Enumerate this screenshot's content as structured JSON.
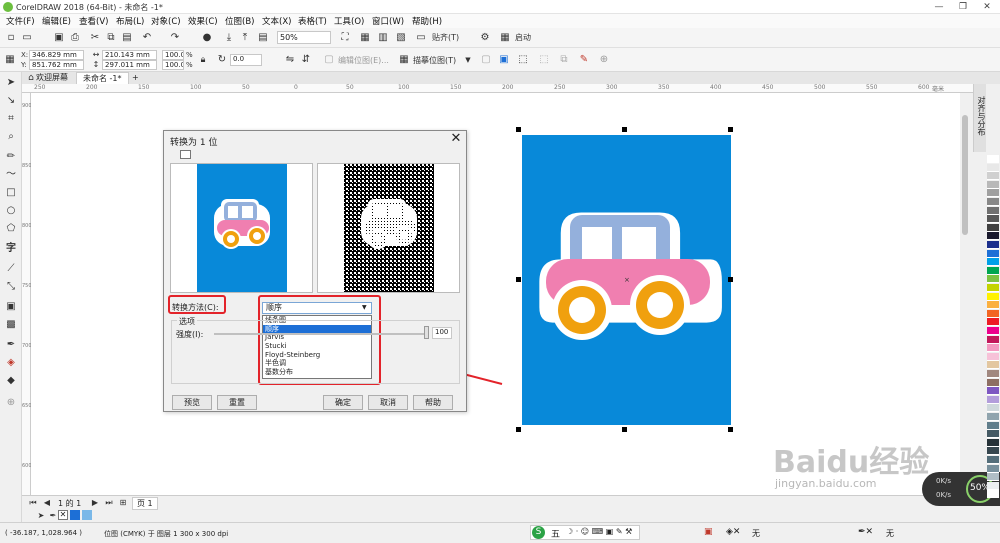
{
  "window": {
    "title": "CorelDRAW 2018 (64-Bit) - 未命名 -1*",
    "minimize": "—",
    "restore": "❐",
    "close": "✕"
  },
  "menu": [
    "文件(F)",
    "编辑(E)",
    "查看(V)",
    "布局(L)",
    "对象(C)",
    "效果(C)",
    "位图(B)",
    "文本(X)",
    "表格(T)",
    "工具(O)",
    "窗口(W)",
    "帮助(H)"
  ],
  "toolbar": {
    "zoom_value": "50%",
    "snap_label": "贴齐(T)",
    "launch_label": "启动"
  },
  "propbar": {
    "x_label": "X:",
    "x_value": "346.829 mm",
    "y_label": "Y:",
    "y_value": "851.762 mm",
    "w_value": "210.143 mm",
    "h_value": "297.011 mm",
    "scale_w": "100.0",
    "scale_h": "100.0",
    "percent": "%",
    "rotate_value": "0.0",
    "edit_bitmap": "编辑位图(E)...",
    "trace_bitmap": "描摹位图(T)"
  },
  "doctabs": {
    "welcome": "欢迎屏幕",
    "doc": "未命名 -1*",
    "add": "+"
  },
  "ruler": {
    "ticks_h": [
      "250",
      "200",
      "150",
      "100",
      "50",
      "0",
      "50",
      "100",
      "150",
      "200",
      "250",
      "300",
      "350",
      "400",
      "450",
      "500",
      "550",
      "600"
    ],
    "ticks_v": [
      "900",
      "850",
      "800",
      "750",
      "700",
      "650",
      "600"
    ],
    "unit": "毫米"
  },
  "docker": {
    "label": "对齐与分布"
  },
  "dialog": {
    "title": "转换为 1 位",
    "close": "✕",
    "method_label": "转换方法(C):",
    "method_selected": "顺序",
    "options_label": "选项",
    "strength_label": "强度(I):",
    "strength_value": "100",
    "dropdown_options": [
      "线条图",
      "顺序",
      "Jarvis",
      "Stucki",
      "Floyd-Steinberg",
      "半色调",
      "基数分布"
    ],
    "dropdown_selected_index": 1,
    "buttons": {
      "preview": "预览",
      "reset": "重置",
      "ok": "确定",
      "cancel": "取消",
      "help": "帮助"
    }
  },
  "pagebar": {
    "page_of": "1 的 1",
    "page_tab": "页 1"
  },
  "status": {
    "coords": "( -36.187, 1,028.964 )",
    "object_info": "位图 (CMYK) 于 图层 1 300 x 300 dpi",
    "ime_label": "五",
    "fill_none": "无",
    "outline_none": "无"
  },
  "watermark": {
    "brand": "Baidu经验",
    "url": "jingyan.baidu.com"
  },
  "gauge": {
    "value": "50%",
    "up": "0K/s",
    "down": "0K/s"
  },
  "colors": {
    "accent": "#1d6fd6",
    "image_blue": "#0889d9",
    "car_body": "#f07fb0",
    "car_roof": "#94b0dc",
    "wheel": "#f0a00e",
    "annotation_red": "#e3232a",
    "palette": [
      "#ffffff",
      "#e8e8e8",
      "#d0d0d0",
      "#b8b8b8",
      "#a0a0a0",
      "#888888",
      "#707070",
      "#585858",
      "#404040",
      "#1a1a2e",
      "#1c2f8c",
      "#1d6fd6",
      "#00a0e8",
      "#00a651",
      "#7dc242",
      "#c3d300",
      "#fff200",
      "#fbb040",
      "#f26522",
      "#ed1c24",
      "#ec008c",
      "#c2185b",
      "#f49ac1",
      "#f7c2d8",
      "#e3c7a0",
      "#a1887f",
      "#8d6e63",
      "#7e57c2",
      "#b39ddb",
      "#cfd8dc",
      "#90a4ae",
      "#607d8b",
      "#455a64",
      "#263238",
      "#37474f",
      "#546e7a",
      "#78909c",
      "#b0bec5",
      "#eceff1",
      "#ffffff"
    ]
  }
}
